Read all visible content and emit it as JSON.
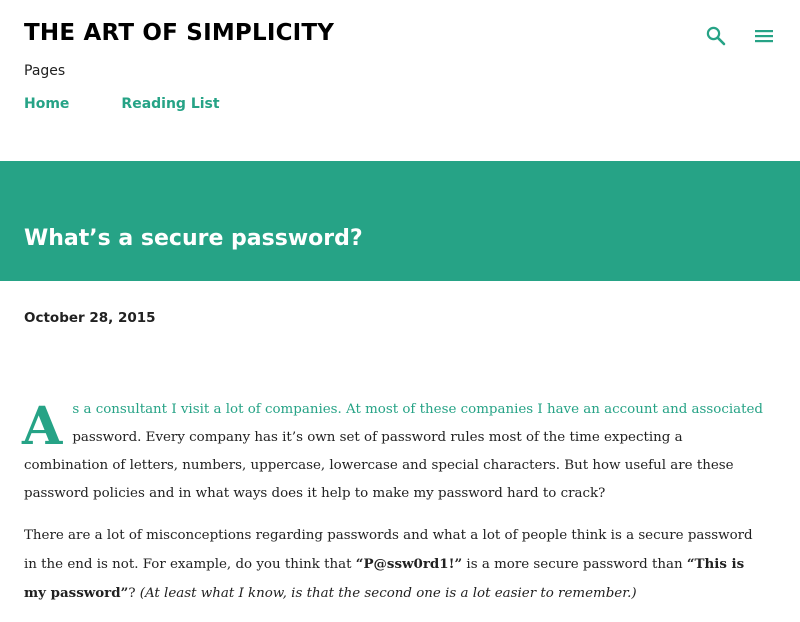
{
  "header": {
    "blog_title": "THE ART OF SIMPLICITY",
    "pages_label": "Pages",
    "nav": [
      {
        "label": "Home"
      },
      {
        "label": "Reading List"
      }
    ],
    "icons": [
      "search-icon",
      "menu-icon"
    ]
  },
  "post": {
    "title": "What’s a secure password?",
    "date": "October 28, 2015",
    "drop_cap": "A",
    "p1_lead": "s a consultant I visit a lot of companies. At most of these companies I have an account and associated",
    "p1_rest": "password. Every company has it’s own set of password rules most of the time expecting a combination of letters, numbers, uppercase, lowercase and special characters. But how useful are these password policies and in what ways does it help to make my password hard to crack?",
    "p2_a": "There are a lot of misconceptions regarding passwords and what a lot of people think is a secure password in the end is not. For example, do you think that ",
    "p2_pw1": "“P@ssw0rd1!”",
    "p2_b": " is a more secure password than ",
    "p2_pw2": "“This is my password”",
    "p2_c": "? ",
    "p2_italic": "(At least what I know, is that the second one is a lot easier to remember.)"
  },
  "colors": {
    "accent": "#26a386",
    "title_text": "#000000",
    "body_text": "#212121",
    "banner_text": "#ffffff",
    "background": "#ffffff"
  }
}
